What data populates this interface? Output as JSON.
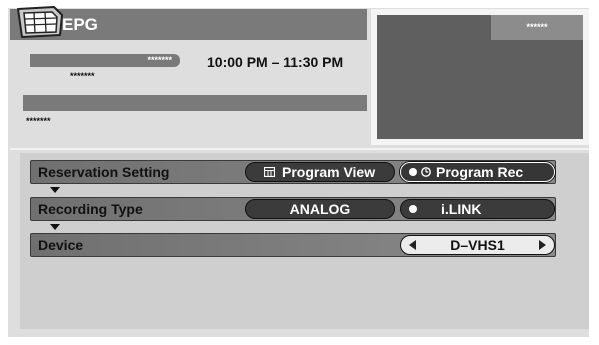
{
  "header": {
    "title": "EPG"
  },
  "program": {
    "name": "*******",
    "sub": "*******",
    "time": "10:00 PM – 11:30 PM",
    "info": "*******"
  },
  "preview": {
    "tag": "******"
  },
  "settings": {
    "reservation": {
      "label": "Reservation Setting",
      "view_label": "Program View",
      "rec_label": "Program Rec"
    },
    "recording_type": {
      "label": "Recording Type",
      "analog_label": "ANALOG",
      "ilink_label": "i.LINK"
    },
    "device": {
      "label": "Device",
      "value": "D–VHS1"
    }
  },
  "colors": {
    "title_bar": "#7a7a7a",
    "screen_bg": "#dedede",
    "panel_bg": "#cfcfcf",
    "preview_bg": "#5f5f5f",
    "pill_dark": "#3b3b3b"
  },
  "icons": [
    "epg-logo-icon",
    "program-guide-icon",
    "clock-icon",
    "radio-dot-icon",
    "arrow-down-icon",
    "left-arrow-icon",
    "right-arrow-icon"
  ]
}
